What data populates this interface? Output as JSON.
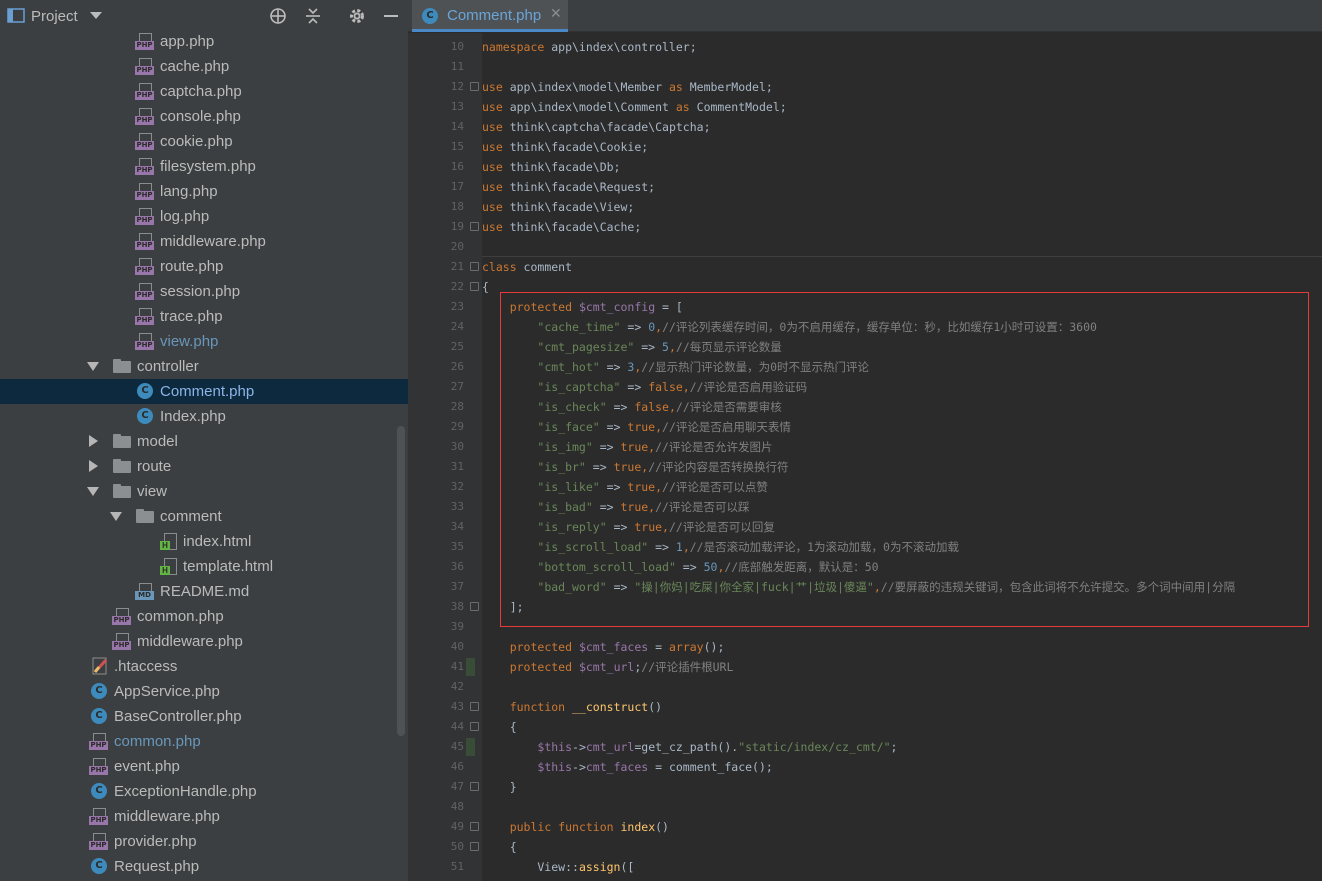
{
  "project_panel": {
    "title": "Project",
    "tree": [
      {
        "label": "app.php",
        "type": "php",
        "depth": 2
      },
      {
        "label": "cache.php",
        "type": "php",
        "depth": 2
      },
      {
        "label": "captcha.php",
        "type": "php",
        "depth": 2
      },
      {
        "label": "console.php",
        "type": "php",
        "depth": 2
      },
      {
        "label": "cookie.php",
        "type": "php",
        "depth": 2
      },
      {
        "label": "filesystem.php",
        "type": "php",
        "depth": 2
      },
      {
        "label": "lang.php",
        "type": "php",
        "depth": 2
      },
      {
        "label": "log.php",
        "type": "php",
        "depth": 2
      },
      {
        "label": "middleware.php",
        "type": "php",
        "depth": 2
      },
      {
        "label": "route.php",
        "type": "php",
        "depth": 2
      },
      {
        "label": "session.php",
        "type": "php",
        "depth": 2
      },
      {
        "label": "trace.php",
        "type": "php",
        "depth": 2
      },
      {
        "label": "view.php",
        "type": "php",
        "depth": 2,
        "color": "blue"
      },
      {
        "label": "controller",
        "type": "folder",
        "depth": 1,
        "expanded": true
      },
      {
        "label": "Comment.php",
        "type": "class",
        "depth": 2,
        "selected": true
      },
      {
        "label": "Index.php",
        "type": "class",
        "depth": 2
      },
      {
        "label": "model",
        "type": "folder",
        "depth": 1,
        "expanded": false
      },
      {
        "label": "route",
        "type": "folder",
        "depth": 1,
        "expanded": false
      },
      {
        "label": "view",
        "type": "folder",
        "depth": 1,
        "expanded": true
      },
      {
        "label": "comment",
        "type": "folder",
        "depth": 2,
        "expanded": true
      },
      {
        "label": "index.html",
        "type": "html",
        "depth": 3
      },
      {
        "label": "template.html",
        "type": "html",
        "depth": 3
      },
      {
        "label": "README.md",
        "type": "md",
        "depth": 2
      },
      {
        "label": "common.php",
        "type": "php",
        "depth": 1
      },
      {
        "label": "middleware.php",
        "type": "php",
        "depth": 1
      },
      {
        "label": ".htaccess",
        "type": "htaccess",
        "depth": 0
      },
      {
        "label": "AppService.php",
        "type": "class",
        "depth": 0
      },
      {
        "label": "BaseController.php",
        "type": "class",
        "depth": 0
      },
      {
        "label": "common.php",
        "type": "php",
        "depth": 0,
        "color": "blue"
      },
      {
        "label": "event.php",
        "type": "php",
        "depth": 0
      },
      {
        "label": "ExceptionHandle.php",
        "type": "class",
        "depth": 0
      },
      {
        "label": "middleware.php",
        "type": "php",
        "depth": 0
      },
      {
        "label": "provider.php",
        "type": "php",
        "depth": 0
      },
      {
        "label": "Request.php",
        "type": "class",
        "depth": 0
      }
    ],
    "header_icons": [
      "locate-icon",
      "collapse-all-icon",
      "gear-icon",
      "minimize-icon"
    ]
  },
  "editor": {
    "tab": {
      "label": "Comment.php",
      "close": "✕"
    },
    "colors": {
      "keyword": "#cc7832",
      "string": "#6a8759",
      "number": "#6897bb",
      "variable": "#9876aa",
      "comment": "#808080",
      "function": "#ffc66d",
      "text": "#a9b7c6",
      "highlight_box": "#e53b3b"
    },
    "lines": [
      {
        "n": "10",
        "tokens": [
          [
            "kw",
            "namespace"
          ],
          [
            "plain",
            " app\\index\\controller;"
          ]
        ]
      },
      {
        "n": "11",
        "tokens": []
      },
      {
        "n": "12",
        "tokens": [
          [
            "kw",
            "use"
          ],
          [
            "plain",
            " app\\index\\model\\Member "
          ],
          [
            "kw",
            "as"
          ],
          [
            "plain",
            " MemberModel;"
          ]
        ]
      },
      {
        "n": "13",
        "tokens": [
          [
            "kw",
            "use"
          ],
          [
            "plain",
            " app\\index\\model\\Comment "
          ],
          [
            "kw",
            "as"
          ],
          [
            "plain",
            " CommentModel;"
          ]
        ]
      },
      {
        "n": "14",
        "tokens": [
          [
            "kw",
            "use"
          ],
          [
            "plain",
            " think\\captcha\\facade\\Captcha;"
          ]
        ]
      },
      {
        "n": "15",
        "tokens": [
          [
            "kw",
            "use"
          ],
          [
            "plain",
            " think\\facade\\Cookie;"
          ]
        ]
      },
      {
        "n": "16",
        "tokens": [
          [
            "kw",
            "use"
          ],
          [
            "plain",
            " think\\facade\\Db;"
          ]
        ]
      },
      {
        "n": "17",
        "tokens": [
          [
            "kw",
            "use"
          ],
          [
            "plain",
            " think\\facade\\Request;"
          ]
        ]
      },
      {
        "n": "18",
        "tokens": [
          [
            "kw",
            "use"
          ],
          [
            "plain",
            " think\\facade\\View;"
          ]
        ]
      },
      {
        "n": "19",
        "tokens": [
          [
            "kw",
            "use"
          ],
          [
            "plain",
            " think\\facade\\Cache;"
          ]
        ]
      },
      {
        "n": "20",
        "tokens": []
      },
      {
        "n": "21",
        "tokens": [
          [
            "kw",
            "class"
          ],
          [
            "plain",
            " comment"
          ]
        ]
      },
      {
        "n": "22",
        "tokens": [
          [
            "plain",
            "{"
          ]
        ]
      },
      {
        "n": "23",
        "tokens": [
          [
            "plain",
            "    "
          ],
          [
            "kw",
            "protected"
          ],
          [
            "plain",
            " "
          ],
          [
            "var",
            "$cmt_config"
          ],
          [
            "plain",
            " = ["
          ]
        ]
      },
      {
        "n": "24",
        "tokens": [
          [
            "plain",
            "        "
          ],
          [
            "str",
            "\"cache_time\""
          ],
          [
            "plain",
            " => "
          ],
          [
            "num",
            "0"
          ],
          [
            "kw",
            ","
          ],
          [
            "cmt",
            "//评论列表缓存时间，0为不启用缓存，缓存单位：秒，比如缓存1小时可设置：3600"
          ]
        ]
      },
      {
        "n": "25",
        "tokens": [
          [
            "plain",
            "        "
          ],
          [
            "str",
            "\"cmt_pagesize\""
          ],
          [
            "plain",
            " => "
          ],
          [
            "num",
            "5"
          ],
          [
            "kw",
            ","
          ],
          [
            "cmt",
            "//每页显示评论数量"
          ]
        ]
      },
      {
        "n": "26",
        "tokens": [
          [
            "plain",
            "        "
          ],
          [
            "str",
            "\"cmt_hot\""
          ],
          [
            "plain",
            " => "
          ],
          [
            "num",
            "3"
          ],
          [
            "kw",
            ","
          ],
          [
            "cmt",
            "//显示热门评论数量，为0时不显示热门评论"
          ]
        ]
      },
      {
        "n": "27",
        "tokens": [
          [
            "plain",
            "        "
          ],
          [
            "str",
            "\"is_captcha\""
          ],
          [
            "plain",
            " => "
          ],
          [
            "kw",
            "false,"
          ],
          [
            "cmt",
            "//评论是否启用验证码"
          ]
        ]
      },
      {
        "n": "28",
        "tokens": [
          [
            "plain",
            "        "
          ],
          [
            "str",
            "\"is_check\""
          ],
          [
            "plain",
            " => "
          ],
          [
            "kw",
            "false,"
          ],
          [
            "cmt",
            "//评论是否需要审核"
          ]
        ]
      },
      {
        "n": "29",
        "tokens": [
          [
            "plain",
            "        "
          ],
          [
            "str",
            "\"is_face\""
          ],
          [
            "plain",
            " => "
          ],
          [
            "kw",
            "true,"
          ],
          [
            "cmt",
            "//评论是否启用聊天表情"
          ]
        ]
      },
      {
        "n": "30",
        "tokens": [
          [
            "plain",
            "        "
          ],
          [
            "str",
            "\"is_img\""
          ],
          [
            "plain",
            " => "
          ],
          [
            "kw",
            "true,"
          ],
          [
            "cmt",
            "//评论是否允许发图片"
          ]
        ]
      },
      {
        "n": "31",
        "tokens": [
          [
            "plain",
            "        "
          ],
          [
            "str",
            "\"is_br\""
          ],
          [
            "plain",
            " => "
          ],
          [
            "kw",
            "true,"
          ],
          [
            "cmt",
            "//评论内容是否转换换行符"
          ]
        ]
      },
      {
        "n": "32",
        "tokens": [
          [
            "plain",
            "        "
          ],
          [
            "str",
            "\"is_like\""
          ],
          [
            "plain",
            " => "
          ],
          [
            "kw",
            "true,"
          ],
          [
            "cmt",
            "//评论是否可以点赞"
          ]
        ]
      },
      {
        "n": "33",
        "tokens": [
          [
            "plain",
            "        "
          ],
          [
            "str",
            "\"is_bad\""
          ],
          [
            "plain",
            " => "
          ],
          [
            "kw",
            "true,"
          ],
          [
            "cmt",
            "//评论是否可以踩"
          ]
        ]
      },
      {
        "n": "34",
        "tokens": [
          [
            "plain",
            "        "
          ],
          [
            "str",
            "\"is_reply\""
          ],
          [
            "plain",
            " => "
          ],
          [
            "kw",
            "true,"
          ],
          [
            "cmt",
            "//评论是否可以回复"
          ]
        ]
      },
      {
        "n": "35",
        "tokens": [
          [
            "plain",
            "        "
          ],
          [
            "str",
            "\"is_scroll_load\""
          ],
          [
            "plain",
            " => "
          ],
          [
            "num",
            "1"
          ],
          [
            "kw",
            ","
          ],
          [
            "cmt",
            "//是否滚动加载评论，1为滚动加载，0为不滚动加载"
          ]
        ]
      },
      {
        "n": "36",
        "tokens": [
          [
            "plain",
            "        "
          ],
          [
            "str",
            "\"bottom_scroll_load\""
          ],
          [
            "plain",
            " => "
          ],
          [
            "num",
            "50"
          ],
          [
            "kw",
            ","
          ],
          [
            "cmt",
            "//底部触发距离，默认是：50"
          ]
        ]
      },
      {
        "n": "37",
        "tokens": [
          [
            "plain",
            "        "
          ],
          [
            "str",
            "\"bad_word\""
          ],
          [
            "plain",
            " => "
          ],
          [
            "str",
            "\"操|你妈|吃屎|你全家|fuck|艹|垃圾|傻逼\""
          ],
          [
            "kw",
            ","
          ],
          [
            "cmt",
            "//要屏蔽的违规关键词，包含此词将不允许提交。多个词中间用|分隔"
          ]
        ]
      },
      {
        "n": "38",
        "tokens": [
          [
            "plain",
            "    ];"
          ]
        ]
      },
      {
        "n": "39",
        "tokens": []
      },
      {
        "n": "40",
        "tokens": [
          [
            "plain",
            "    "
          ],
          [
            "kw",
            "protected"
          ],
          [
            "plain",
            " "
          ],
          [
            "var",
            "$cmt_faces"
          ],
          [
            "plain",
            " = "
          ],
          [
            "kw",
            "array"
          ],
          [
            "plain",
            "();"
          ]
        ]
      },
      {
        "n": "41",
        "tokens": [
          [
            "plain",
            "    "
          ],
          [
            "kw",
            "protected"
          ],
          [
            "plain",
            " "
          ],
          [
            "var",
            "$cmt_url"
          ],
          [
            "plain",
            ";"
          ],
          [
            "cmt",
            "//评论插件根URL"
          ]
        ]
      },
      {
        "n": "42",
        "tokens": []
      },
      {
        "n": "43",
        "tokens": [
          [
            "plain",
            "    "
          ],
          [
            "kw",
            "function"
          ],
          [
            "plain",
            " "
          ],
          [
            "fn",
            "__construct"
          ],
          [
            "plain",
            "()"
          ]
        ]
      },
      {
        "n": "44",
        "tokens": [
          [
            "plain",
            "    {"
          ]
        ]
      },
      {
        "n": "45",
        "tokens": [
          [
            "plain",
            "        "
          ],
          [
            "var",
            "$this"
          ],
          [
            "plain",
            "->"
          ],
          [
            "var",
            "cmt_url"
          ],
          [
            "plain",
            "=get_cz_path()."
          ],
          [
            "str",
            "\"static/index/cz_cmt/\""
          ],
          [
            "plain",
            ";"
          ]
        ]
      },
      {
        "n": "46",
        "tokens": [
          [
            "plain",
            "        "
          ],
          [
            "var",
            "$this"
          ],
          [
            "plain",
            "->"
          ],
          [
            "var",
            "cmt_faces"
          ],
          [
            "plain",
            " = comment_face();"
          ]
        ]
      },
      {
        "n": "47",
        "tokens": [
          [
            "plain",
            "    }"
          ]
        ]
      },
      {
        "n": "48",
        "tokens": []
      },
      {
        "n": "49",
        "tokens": [
          [
            "plain",
            "    "
          ],
          [
            "kw",
            "public function"
          ],
          [
            "plain",
            " "
          ],
          [
            "fn",
            "index"
          ],
          [
            "plain",
            "()"
          ]
        ]
      },
      {
        "n": "50",
        "tokens": [
          [
            "plain",
            "    {"
          ]
        ]
      },
      {
        "n": "51",
        "tokens": [
          [
            "plain",
            "        View::"
          ],
          [
            "fn",
            "assign"
          ],
          [
            "plain",
            "(["
          ]
        ]
      }
    ]
  }
}
